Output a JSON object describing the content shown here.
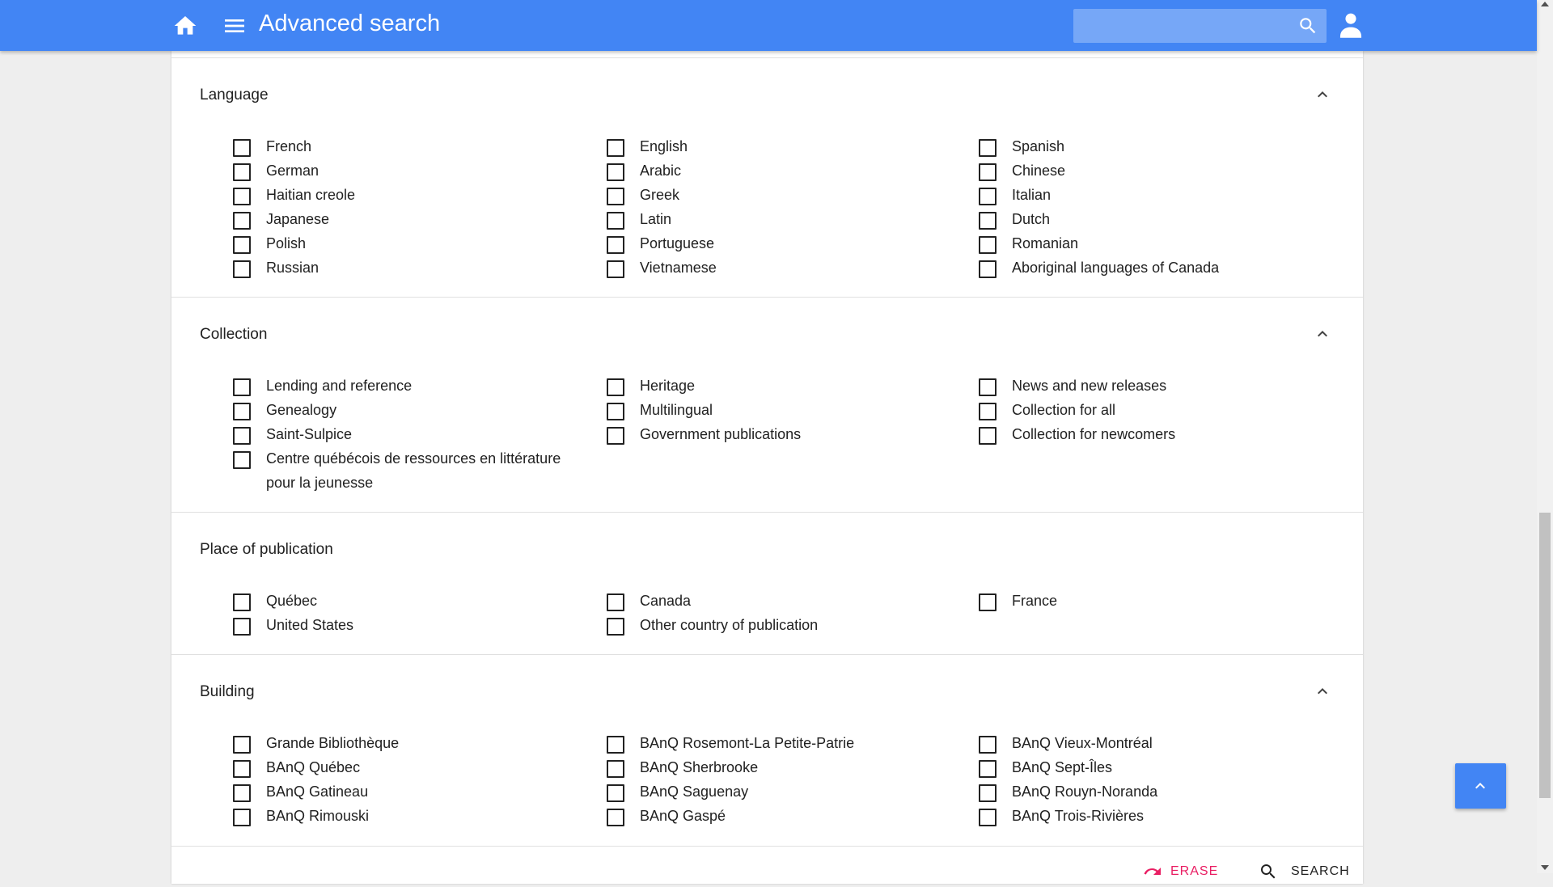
{
  "header": {
    "title": "Advanced search",
    "search_value": "",
    "icons": [
      "home-icon",
      "menu-icon",
      "search-icon",
      "user-icon"
    ]
  },
  "sections": [
    {
      "title": "Language",
      "collapsible": true,
      "columns": [
        [
          "French",
          "German",
          "Haitian creole",
          "Japanese",
          "Polish",
          "Russian"
        ],
        [
          "English",
          "Arabic",
          "Greek",
          "Latin",
          "Portuguese",
          "Vietnamese"
        ],
        [
          "Spanish",
          "Chinese",
          "Italian",
          "Dutch",
          "Romanian",
          "Aboriginal languages of Canada"
        ]
      ]
    },
    {
      "title": "Collection",
      "collapsible": true,
      "columns": [
        [
          "Lending and reference",
          "Genealogy",
          "Saint-Sulpice",
          "Centre québécois de ressources en littérature pour la jeunesse"
        ],
        [
          "Heritage",
          "Multilingual",
          "Government publications"
        ],
        [
          "News and new releases",
          "Collection for all",
          "Collection for newcomers"
        ]
      ]
    },
    {
      "title": "Place of publication",
      "collapsible": false,
      "columns": [
        [
          "Québec",
          "United States"
        ],
        [
          "Canada",
          "Other country of publication"
        ],
        [
          "France"
        ]
      ]
    },
    {
      "title": "Building",
      "collapsible": true,
      "columns": [
        [
          "Grande Bibliothèque",
          "BAnQ Québec",
          "BAnQ Gatineau",
          "BAnQ Rimouski"
        ],
        [
          "BAnQ Rosemont-La Petite-Patrie",
          "BAnQ Sherbrooke",
          "BAnQ Saguenay",
          "BAnQ Gaspé"
        ],
        [
          "BAnQ Vieux-Montréal",
          "BAnQ Sept-Îles",
          "BAnQ Rouyn-Noranda",
          "BAnQ Trois-Rivières"
        ]
      ]
    }
  ],
  "actions": {
    "erase_label": "ERASE",
    "search_label": "SEARCH"
  },
  "colors": {
    "primary": "#4285f4",
    "erase": "#e91e63"
  }
}
